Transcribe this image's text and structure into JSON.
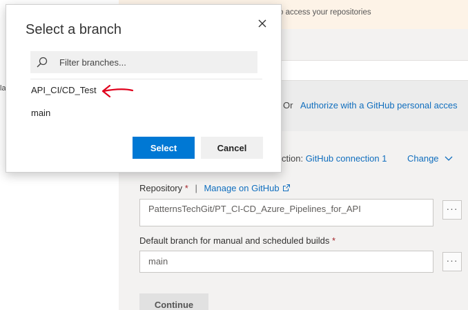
{
  "background": {
    "left_fragment": "la",
    "warning_text": "o access your repositories",
    "auth": {
      "or_text": "Or",
      "link_text": "Authorize with a GitHub personal acces"
    },
    "connection": {
      "prefix": "ction: ",
      "name": "GitHub connection 1",
      "change_label": "Change"
    },
    "repository": {
      "label": "Repository",
      "required_mark": "*",
      "separator": "|",
      "manage_link": "Manage on GitHub",
      "value": "PatternsTechGit/PT_CI-CD_Azure_Pipelines_for_API",
      "more_label": "···"
    },
    "default_branch": {
      "label": "Default branch for manual and scheduled builds",
      "required_mark": "*",
      "value": "main",
      "more_label": "···"
    },
    "continue_label": "Continue"
  },
  "dialog": {
    "title": "Select a branch",
    "filter_placeholder": "Filter branches...",
    "branches": [
      "API_CI/CD_Test",
      "main"
    ],
    "select_label": "Select",
    "cancel_label": "Cancel",
    "annotation_color": "#e0001b"
  }
}
